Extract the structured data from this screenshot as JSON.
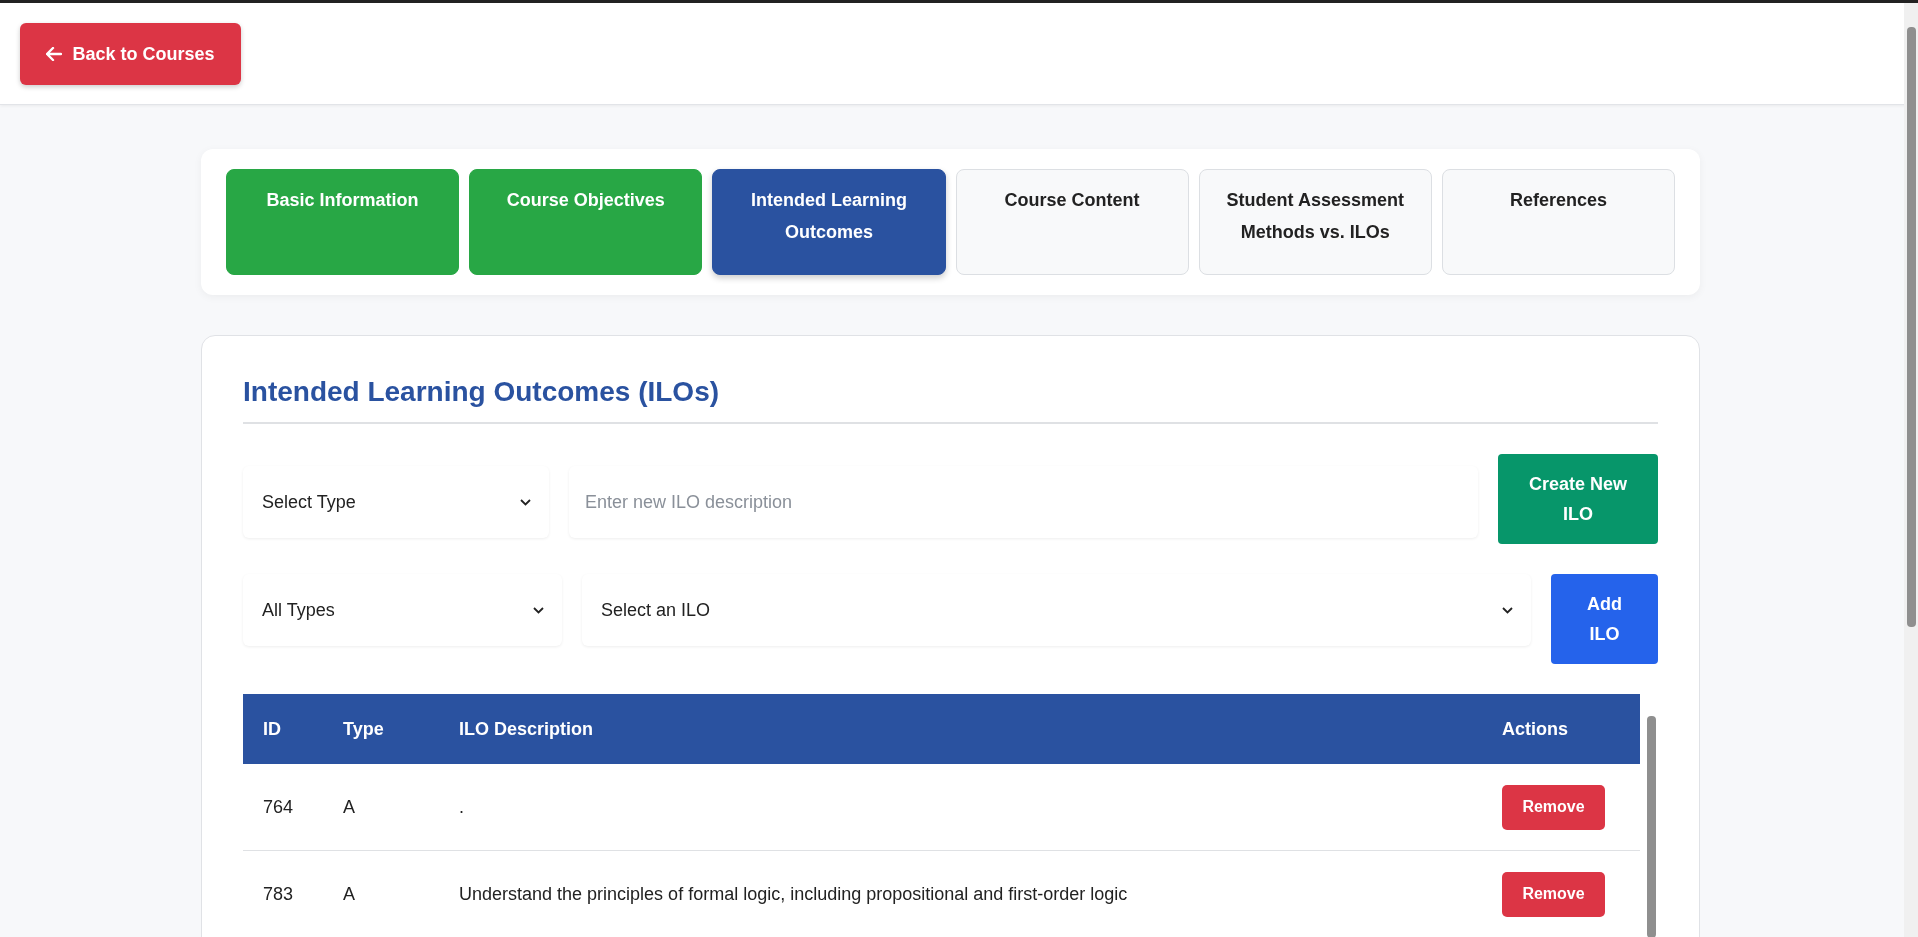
{
  "back_button": {
    "label": "Back to Courses"
  },
  "tabs": [
    {
      "label": "Basic Information",
      "completed": true,
      "selected": false
    },
    {
      "label": "Course Objectives",
      "completed": true,
      "selected": false
    },
    {
      "label": "Intended Learning Outcomes",
      "completed": false,
      "selected": true
    },
    {
      "label": "Course Content",
      "completed": false,
      "selected": false
    },
    {
      "label": "Student Assessment Methods vs. ILOs",
      "completed": false,
      "selected": false
    },
    {
      "label": "References",
      "completed": false,
      "selected": false
    }
  ],
  "section": {
    "title": "Intended Learning Outcomes (ILOs)"
  },
  "create_form": {
    "type_select": {
      "value": "Select Type"
    },
    "description": {
      "placeholder": "Enter new ILO description"
    },
    "button": "Create New ILO"
  },
  "add_form": {
    "filter_select": {
      "value": "All Types"
    },
    "ilo_select": {
      "value": "Select an ILO"
    },
    "button": "Add ILO"
  },
  "table": {
    "columns": [
      "ID",
      "Type",
      "ILO Description",
      "Actions"
    ],
    "rows": [
      {
        "id": "764",
        "type": "A",
        "description": ".",
        "action": "Remove"
      },
      {
        "id": "783",
        "type": "A",
        "description": "Understand the principles of formal logic, including propositional and first-order logic",
        "action": "Remove"
      }
    ]
  }
}
